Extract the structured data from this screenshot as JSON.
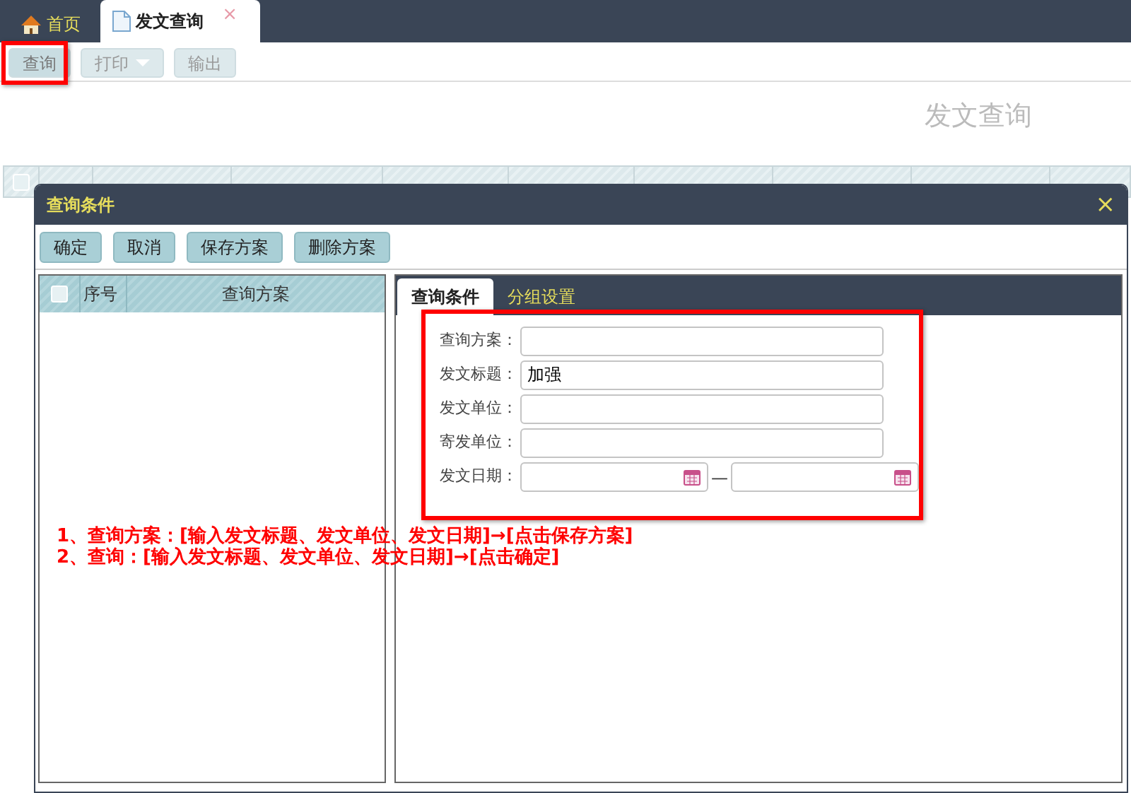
{
  "top_tabs": [
    {
      "label": "首页",
      "kind": "home",
      "selected": false
    },
    {
      "label": "发文查询",
      "kind": "page",
      "selected": true,
      "close": "×"
    }
  ],
  "toolbar": [
    {
      "label": "查询",
      "dropdown": false,
      "highlighted": true
    },
    {
      "label": "打印",
      "dropdown": true,
      "highlighted": false
    },
    {
      "label": "输出",
      "dropdown": false,
      "highlighted": false
    }
  ],
  "page_title": "发文查询",
  "grid_header": {
    "checked": false
  },
  "dialog": {
    "title": "查询条件",
    "close": "×",
    "buttons": [
      "确定",
      "取消",
      "保存方案",
      "删除方案"
    ],
    "scheme_list": {
      "checked": false,
      "columns": [
        "序号",
        "查询方案"
      ]
    },
    "tabs": [
      {
        "label": "查询条件",
        "selected": true
      },
      {
        "label": "分组设置",
        "selected": false
      }
    ],
    "form_highlighted": true,
    "fields": [
      {
        "label": "查询方案：",
        "kind": "text"
      },
      {
        "label": "发文标题：",
        "kind": "text",
        "value": "加强"
      },
      {
        "label": "发文单位：",
        "kind": "text"
      },
      {
        "label": "寄发单位：",
        "kind": "text"
      },
      {
        "label": "发文日期：",
        "kind": "date_range",
        "separator": "—"
      }
    ]
  },
  "annotations": [
    "1、查询方案：[输入发文标题、发文单位、发文日期]→[点击保存方案]",
    "2、查询：[输入发文标题、发文单位、发文日期]→[点击确定]"
  ]
}
